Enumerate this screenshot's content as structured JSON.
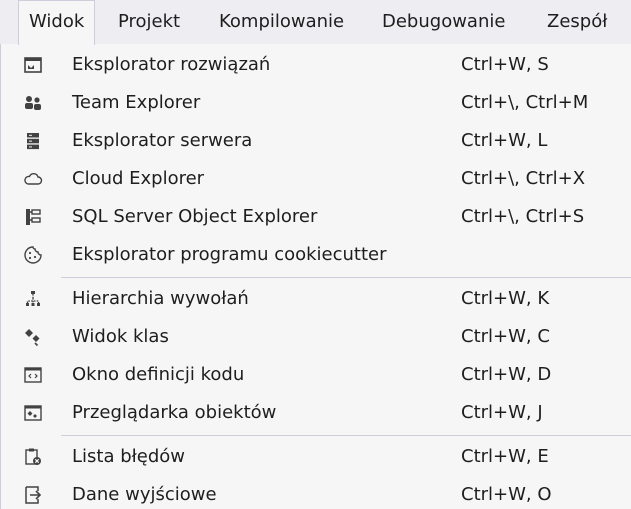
{
  "menubar": {
    "items": [
      {
        "label": "Widok"
      },
      {
        "label": "Projekt"
      },
      {
        "label": "Kompilowanie"
      },
      {
        "label": "Debugowanie"
      },
      {
        "label": "Zespół"
      }
    ]
  },
  "menu": {
    "items": [
      {
        "label": "Eksplorator rozwiązań",
        "shortcut": "Ctrl+W, S",
        "icon": "solution-explorer-icon"
      },
      {
        "label": "Team Explorer",
        "shortcut": "Ctrl+\\, Ctrl+M",
        "icon": "team-explorer-icon"
      },
      {
        "label": "Eksplorator serwera",
        "shortcut": "Ctrl+W, L",
        "icon": "server-explorer-icon"
      },
      {
        "label": "Cloud Explorer",
        "shortcut": "Ctrl+\\, Ctrl+X",
        "icon": "cloud-icon"
      },
      {
        "label": "SQL Server Object Explorer",
        "shortcut": "Ctrl+\\, Ctrl+S",
        "icon": "sql-server-object-explorer-icon"
      },
      {
        "label": "Eksplorator programu cookiecutter",
        "shortcut": "",
        "icon": "cookie-icon"
      },
      {
        "label": "Hierarchia wywołań",
        "shortcut": "Ctrl+W, K",
        "icon": "call-hierarchy-icon"
      },
      {
        "label": "Widok klas",
        "shortcut": "Ctrl+W, C",
        "icon": "class-view-icon"
      },
      {
        "label": "Okno definicji kodu",
        "shortcut": "Ctrl+W, D",
        "icon": "code-definition-icon"
      },
      {
        "label": "Przeglądarka obiektów",
        "shortcut": "Ctrl+W, J",
        "icon": "object-browser-icon"
      },
      {
        "label": "Lista błędów",
        "shortcut": "Ctrl+W, E",
        "icon": "error-list-icon"
      },
      {
        "label": "Dane wyjściowe",
        "shortcut": "Ctrl+W, O",
        "icon": "output-icon"
      }
    ]
  }
}
